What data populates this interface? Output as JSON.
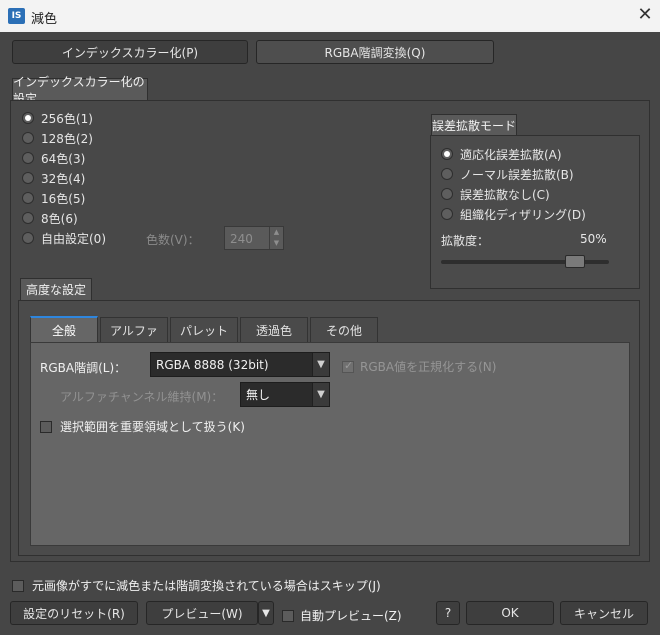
{
  "window": {
    "title": "減色",
    "app_icon": "IS",
    "close_glyph": "✕"
  },
  "main_tabs": [
    {
      "label": "インデックスカラー化(P)"
    },
    {
      "label": "RGBA階調変換(Q)"
    }
  ],
  "index_settings": {
    "title": "インデックスカラー化の設定",
    "options": [
      "256色(1)",
      "128色(2)",
      "64色(3)",
      "32色(4)",
      "16色(5)",
      "8色(6)",
      "自由設定(0)"
    ],
    "selected_index": 0,
    "color_count_label": "色数(V)：",
    "color_count_value": "240"
  },
  "diffusion": {
    "title": "誤差拡散モード",
    "options": [
      "適応化誤差拡散(A)",
      "ノーマル誤差拡散(B)",
      "誤差拡散なし(C)",
      "組織化ディザリング(D)"
    ],
    "selected_index": 0,
    "degree_label": "拡散度：",
    "degree_value": "50%",
    "degree_fraction": 0.8
  },
  "advanced": {
    "title": "高度な設定",
    "tabs": [
      "全般",
      "アルファ",
      "パレット",
      "透過色",
      "その他"
    ],
    "active_tab": 0,
    "rgba_label": "RGBA階調(L)：",
    "rgba_value": "RGBA 8888 (32bit)",
    "normalize_label": "RGBA値を正規化する(N)",
    "alpha_channel_label": "アルファチャンネル維持(M)：",
    "alpha_channel_value": "無し",
    "selection_label": "選択範囲を重要領域として扱う(K)"
  },
  "skip_label": "元画像がすでに減色または階調変換されている場合はスキップ(J)",
  "footer": {
    "reset": "設定のリセット(R)",
    "preview": "プレビュー(W)",
    "auto_preview": "自動プレビュー(Z)",
    "help": "?",
    "ok": "OK",
    "cancel": "キャンセル"
  }
}
